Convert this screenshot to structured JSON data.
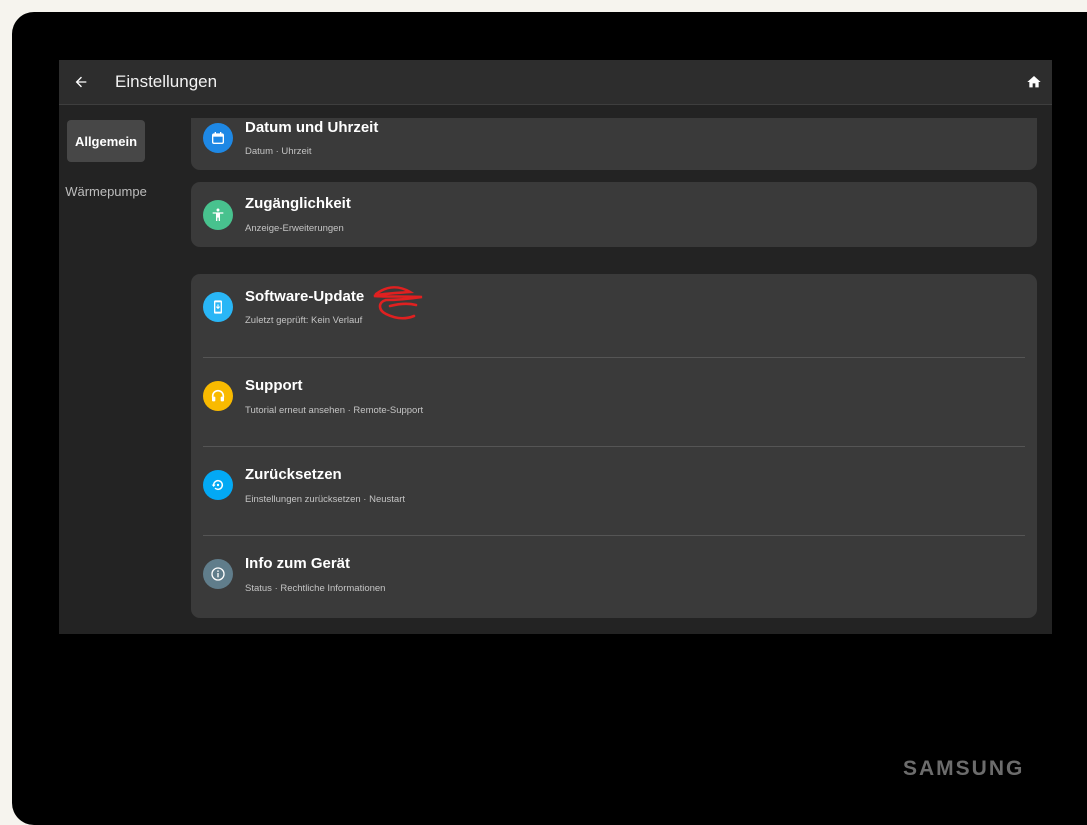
{
  "header": {
    "title": "Einstellungen",
    "back_icon": "arrow-back-icon",
    "home_icon": "home-icon"
  },
  "sidebar": {
    "items": [
      {
        "label": "Allgemein",
        "active": true
      },
      {
        "label": "Wärmepumpe",
        "active": false
      }
    ]
  },
  "settings": {
    "date_time": {
      "title": "Datum und Uhrzeit",
      "subtitle": "Datum · Uhrzeit",
      "icon": "calendar-icon",
      "color": "#1e88e5"
    },
    "accessibility": {
      "title": "Zugänglichkeit",
      "subtitle": "Anzeige-Erweiterungen",
      "icon": "accessibility-icon",
      "color": "#48c28e"
    },
    "software_update": {
      "title": "Software-Update",
      "subtitle": "Zuletzt geprüft: Kein Verlauf",
      "icon": "system-update-icon",
      "color": "#29b6f6"
    },
    "support": {
      "title": "Support",
      "subtitle": "Tutorial erneut ansehen · Remote-Support",
      "icon": "headset-icon",
      "color": "#f9ba00"
    },
    "reset": {
      "title": "Zurücksetzen",
      "subtitle": "Einstellungen zurücksetzen · Neustart",
      "icon": "restore-icon",
      "color": "#03a9f4"
    },
    "device_info": {
      "title": "Info zum Gerät",
      "subtitle": "Status · Rechtliche Informationen",
      "icon": "info-icon",
      "color": "#607d8b"
    }
  },
  "brand": "SAMSUNG",
  "colors": {
    "annotation": "#e02020"
  }
}
